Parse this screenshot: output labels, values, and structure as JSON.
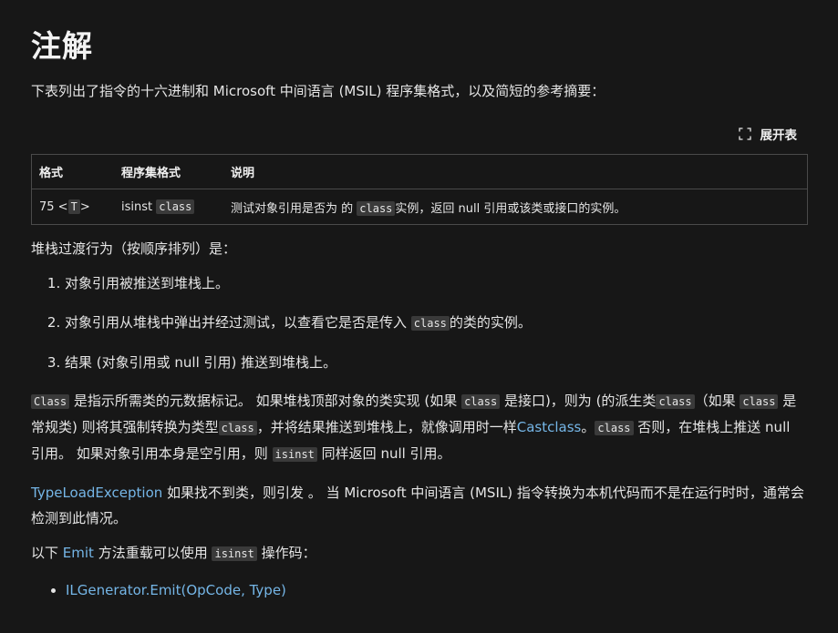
{
  "heading": "注解",
  "intro": "下表列出了指令的十六进制和 Microsoft 中间语言 (MSIL) 程序集格式，以及简短的参考摘要：",
  "expand_label": "展开表",
  "table": {
    "headers": [
      "格式",
      "程序集格式",
      "说明"
    ],
    "row": {
      "format_prefix": "75 <",
      "format_code": "T",
      "format_suffix": ">",
      "asm_text": "isinst ",
      "asm_code": "class",
      "desc_prefix": "测试对象引用是否为 的 ",
      "desc_code": "class",
      "desc_suffix": "实例，返回 null 引用或该类或接口的实例。"
    }
  },
  "stack_intro": "堆栈过渡行为（按顺序排列）是：",
  "steps": {
    "step1": "对象引用被推送到堆栈上。",
    "step2_prefix": "对象引用从堆栈中弹出并经过测试，以查看它是否是传入 ",
    "step2_code": "class",
    "step2_suffix": "的类的实例。",
    "step3": "结果 (对象引用或 null 引用) 推送到堆栈上。"
  },
  "para1": {
    "code1": "Class",
    "t1": " 是指示所需类的元数据标记。 如果堆栈顶部对象的类实现 (如果 ",
    "code2": "class",
    "t2": " 是接口)，则为 (的派生类",
    "code3": "class",
    "t3": "（如果 ",
    "code4": "class",
    "t4": " 是常规类) 则将其强制转换为类型",
    "code5": "class",
    "t5": "，并将结果推送到堆栈上，就像调用时一样",
    "link1": "Castclass",
    "t6": "。",
    "code6": "class",
    "t7": " 否则，在堆栈上推送 null 引用。 如果对象引用本身是空引用，则 ",
    "code7": "isinst",
    "t8": " 同样返回 null 引用。"
  },
  "para2": {
    "link": "TypeLoadException",
    "text": " 如果找不到类，则引发 。 当 Microsoft 中间语言 (MSIL) 指令转换为本机代码而不是在运行时时，通常会检测到此情况。"
  },
  "para3": {
    "t1": "以下 ",
    "link": "Emit",
    "t2": " 方法重载可以使用 ",
    "code": "isinst",
    "t3": " 操作码："
  },
  "overloads": [
    "ILGenerator.Emit(OpCode, Type)"
  ],
  "colors": {
    "background": "#171717",
    "text": "#e6e6e6",
    "link": "#75b6e7",
    "code_bg": "#3a3a3a",
    "border": "#4a4a4a"
  }
}
